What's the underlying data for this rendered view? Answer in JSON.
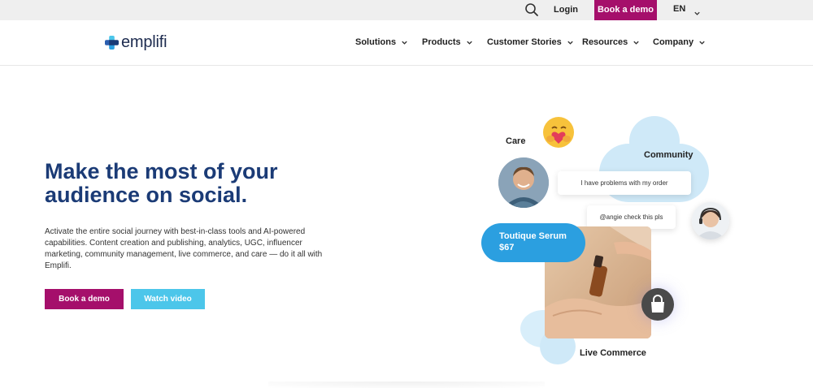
{
  "topbar": {
    "search_icon": "search-icon",
    "login": "Login",
    "book_demo": "Book a demo",
    "language": "EN"
  },
  "nav": {
    "logo_text": "emplifi",
    "items": [
      {
        "label": "Solutions"
      },
      {
        "label": "Products"
      },
      {
        "label": "Customer Stories"
      },
      {
        "label": "Resources"
      },
      {
        "label": "Company"
      }
    ]
  },
  "hero": {
    "headline_line1": "Make the most of your",
    "headline_line2": "audience on social.",
    "description": "Activate the entire social journey with best-in-class tools and AI-powered capabilities. Content creation and publishing, analytics, UGC, influencer marketing, community management, live commerce, and care — do it all with Emplifi.",
    "primary_button": "Book a demo",
    "secondary_button": "Watch video"
  },
  "illustration": {
    "label_care": "Care",
    "label_community": "Community",
    "label_live_commerce": "Live Commerce",
    "message_1": "I have problems with my order",
    "message_2": "@angie check this pls",
    "product_name": "Toutique Serum",
    "product_price": "$67"
  },
  "colors": {
    "brand_magenta": "#a50f6b",
    "accent_cyan": "#4cc6ea",
    "headline_navy": "#1b3b76",
    "product_blue": "#2b9fe0",
    "cloud_blue": "#cfe9f8"
  }
}
